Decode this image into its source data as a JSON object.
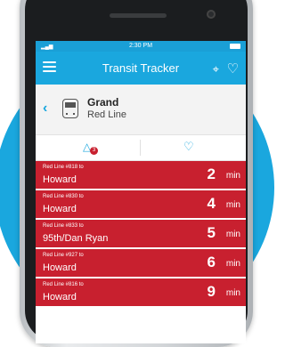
{
  "statusbar": {
    "time": "2:30 PM"
  },
  "appbar": {
    "title": "Transit Tracker"
  },
  "station": {
    "name": "Grand",
    "line": "Red Line"
  },
  "actions": {
    "alert_count": "3"
  },
  "arrivals": [
    {
      "run": "Red Line #818 to",
      "destination": "Howard",
      "minutes": "2",
      "unit": "min"
    },
    {
      "run": "Red Line #830 to",
      "destination": "Howard",
      "minutes": "4",
      "unit": "min"
    },
    {
      "run": "Red Line #833 to",
      "destination": "95th/Dan Ryan",
      "minutes": "5",
      "unit": "min"
    },
    {
      "run": "Red Line #927 to",
      "destination": "Howard",
      "minutes": "6",
      "unit": "min"
    },
    {
      "run": "Red Line #816 to",
      "destination": "Howard",
      "minutes": "9",
      "unit": "min"
    }
  ],
  "colors": {
    "brand": "#1aa7de",
    "red_line": "#c8202f"
  }
}
